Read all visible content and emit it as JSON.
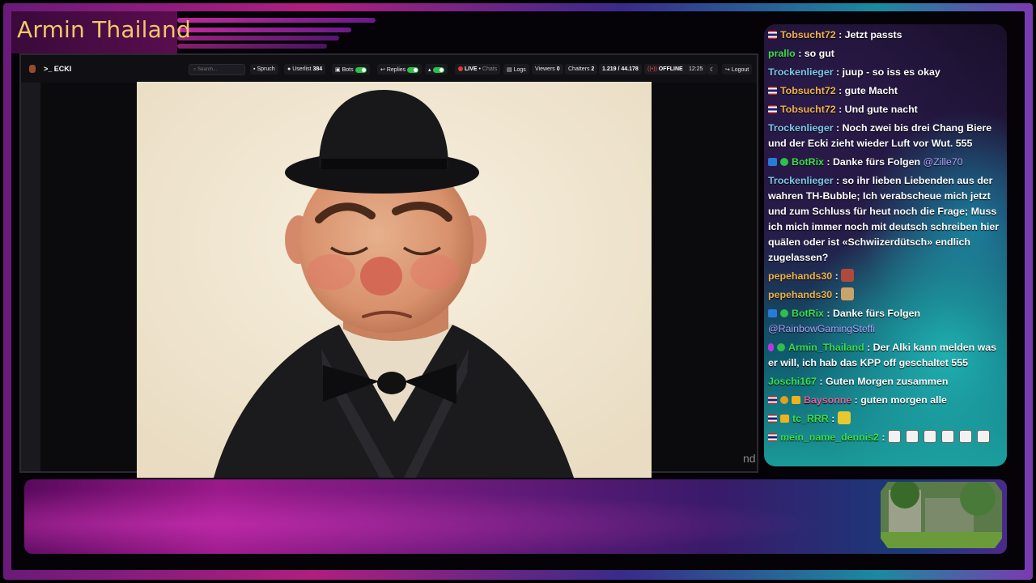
{
  "overlay": {
    "title": "Armin Thailand",
    "corner_text": "nd"
  },
  "navbar": {
    "user": "ECKI",
    "search_placeholder": "Search...",
    "spruch": "Spruch",
    "userlist_label": "Userlist",
    "userlist_count": "384",
    "bots": "Bots",
    "replies": "Replies",
    "live": "LIVE",
    "chats": "Chats",
    "logs": "Logs",
    "viewers_label": "Viewers",
    "viewers_count": "0",
    "chatters_label": "Chatters",
    "chatters_count": "2",
    "followers": "1.219 / 44.178",
    "status": "OFFLINE",
    "time": "12:25",
    "logout": "Logout"
  },
  "chat": [
    {
      "user": "Tobsucht72",
      "color": "#f0b24a",
      "badges": [
        "flag"
      ],
      "text": "Jetzt passts"
    },
    {
      "user": "prallo",
      "color": "#3be04a",
      "badges": [],
      "text": "so gut"
    },
    {
      "user": "Trockenlieger",
      "color": "#7ac8e8",
      "badges": [],
      "text": "juup - so iss es okay"
    },
    {
      "user": "Tobsucht72",
      "color": "#f0b24a",
      "badges": [
        "flag"
      ],
      "text": "gute Macht"
    },
    {
      "user": "Tobsucht72",
      "color": "#f0b24a",
      "badges": [
        "flag"
      ],
      "text": "Und gute nacht"
    },
    {
      "user": "Trockenlieger",
      "color": "#7ac8e8",
      "badges": [],
      "text": "Noch zwei bis drei Chang Biere und der Ecki zieht wieder Luft vor Wut. 555"
    },
    {
      "user": "BotRix",
      "color": "#3be04a",
      "badges": [
        "bot",
        "check"
      ],
      "text": "Danke fürs Folgen",
      "mention": "@Zille70"
    },
    {
      "user": "Trockenlieger",
      "color": "#7ac8e8",
      "badges": [],
      "text": "so ihr lieben Liebenden aus der wahren TH-Bubble; Ich verabscheue mich jetzt und zum Schluss für heut noch die Frage; Muss ich mich immer noch mit deutsch schreiben hier quälen oder ist «Schwiizerdütsch» endlich zugelassen?"
    },
    {
      "user": "pepehands30",
      "color": "#f0b24a",
      "badges": [],
      "text": "",
      "emote": "#b04a3a"
    },
    {
      "user": "pepehands30",
      "color": "#f0b24a",
      "badges": [],
      "text": "",
      "emote": "#c8a46a"
    },
    {
      "user": "BotRix",
      "color": "#3be04a",
      "badges": [
        "bot",
        "check"
      ],
      "text": "Danke fürs Folgen",
      "mention": "@RainbowGamingSteffi"
    },
    {
      "user": "Armin_Thailand",
      "color": "#3be04a",
      "badges": [
        "mod",
        "check"
      ],
      "text": "Der Alki kann melden was er will, ich hab das KPP off geschaltet 555"
    },
    {
      "user": "Joschi167",
      "color": "#3be04a",
      "badges": [],
      "text": "Guten Morgen zusammen"
    },
    {
      "user": "Baysonne",
      "color": "#e0609a",
      "badges": [
        "flag",
        "gold",
        "crown"
      ],
      "text": "guten morgen alle"
    },
    {
      "user": "tc_RRR",
      "color": "#3be04a",
      "badges": [
        "flag",
        "crown"
      ],
      "text": "",
      "emote": "#e8c830"
    },
    {
      "user": "mein_name_dennis2",
      "color": "#3be04a",
      "badges": [
        "flag"
      ],
      "text": "",
      "emote_row": 6
    }
  ]
}
